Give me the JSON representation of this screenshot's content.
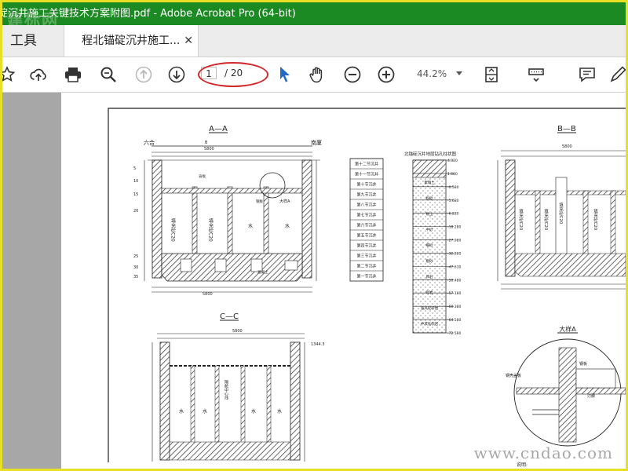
{
  "window": {
    "title": "碇沉井施工关键技术方案附图.pdf - Adobe Acrobat Pro (64-bit)",
    "watermark_logo": "建标网"
  },
  "tabs": {
    "tools_label": "工具",
    "document_label": "程北锚碇沉井施工...",
    "close_symbol": "✕"
  },
  "toolbar": {
    "page_current": "1",
    "page_total": "/ 20",
    "zoom": "44.2%",
    "icons": [
      "star-icon",
      "upload-icon",
      "print-icon",
      "search-zoom-icon",
      "prev-page-icon",
      "next-page-icon",
      "select-pointer-icon",
      "hand-icon",
      "zoom-out-icon",
      "zoom-in-icon",
      "page-fit-icon",
      "scroll-mode-icon",
      "comment-icon",
      "pen-icon"
    ]
  },
  "drawing": {
    "aa": {
      "title": "A—A",
      "label_left": "六合",
      "label_right": "南厦",
      "dim_total": "5800",
      "dim_b": "B",
      "left_dims": [
        "5",
        "10",
        "15",
        "20",
        "25",
        "30",
        "35"
      ],
      "cell_texts": [
        "填充砼C20",
        "水",
        "砼C20"
      ],
      "detail_callout": "大样A",
      "small_labels": [
        "盲板",
        "钢板",
        "混凝土"
      ]
    },
    "bb": {
      "title": "B—B",
      "dim_total": "5800",
      "cell_texts": [
        "填充砼C20",
        "水",
        "砼C20"
      ]
    },
    "cc": {
      "title": "C—C",
      "dim_total": "5800",
      "elev": "1344.3",
      "cell_texts": [
        "水",
        "水",
        "隔舱中心线",
        "水",
        "水"
      ]
    },
    "sections_table": {
      "rows": [
        "第十二节沉井",
        "第十一节沉井",
        "第十节沉井",
        "第九节沉井",
        "第八节沉井",
        "第七节沉井",
        "第六节沉井",
        "第五节沉井",
        "第四节沉井",
        "第三节沉井",
        "第二节沉井",
        "第一节沉井"
      ]
    },
    "bore": {
      "title": "北锚碇沉井地层钻孔柱状图",
      "depths": [
        "4.320",
        "1.680",
        "-0.580",
        "-5.680",
        "-6.280",
        "-18.280",
        "-27.980",
        "-32.880",
        "-47.630",
        "-50.480",
        "-57.180",
        "-60.380",
        "-64.580",
        "-72.580"
      ],
      "layers": [
        "素填土",
        "粉砂",
        "粉土",
        "中砂",
        "细砂",
        "粗砂",
        "卵石",
        "砾岩",
        "强风化砂岩",
        "中风化砂岩"
      ]
    },
    "detail": {
      "title": "大样A",
      "labels": [
        "钢壳盖板",
        "钢板",
        "刃脚"
      ]
    },
    "note": "说明:"
  },
  "site_watermark": "www.cndao.com"
}
